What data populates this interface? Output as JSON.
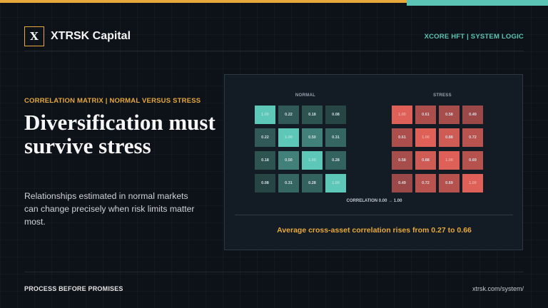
{
  "colors": {
    "accent_gold": "#e6a93a",
    "accent_teal": "#5cc4b4",
    "background": "#0d1219"
  },
  "header": {
    "logo_letter": "X",
    "brand": "XTRSK Capital",
    "tagline": "XCORE HFT | SYSTEM LOGIC"
  },
  "content": {
    "kicker": "CORRELATION MATRIX | NORMAL VERSUS STRESS",
    "headline": "Diversification must survive stress",
    "body": "Relationships estimated in normal markets can change precisely when risk limits matter most."
  },
  "panel": {
    "normal": {
      "title": "NORMAL",
      "values": [
        [
          "1.00",
          "0.22",
          "0.18",
          "0.08"
        ],
        [
          "0.22",
          "1.00",
          "0.50",
          "0.31"
        ],
        [
          "0.18",
          "0.50",
          "1.00",
          "0.28"
        ],
        [
          "0.08",
          "0.31",
          "0.28",
          "1.00"
        ]
      ]
    },
    "stress": {
      "title": "STRESS",
      "values": [
        [
          "1.00",
          "0.61",
          "0.58",
          "0.49"
        ],
        [
          "0.61",
          "1.00",
          "0.88",
          "0.72"
        ],
        [
          "0.58",
          "0.88",
          "1.00",
          "0.69"
        ],
        [
          "0.49",
          "0.72",
          "0.69",
          "1.00"
        ]
      ]
    },
    "scale_label": "CORRELATION 0.00 → 1.00",
    "summary": "Average cross-asset correlation rises from 0.27 to 0.66"
  },
  "footer": {
    "left": "PROCESS BEFORE PROMISES",
    "right": "xtrsk.com/system/"
  }
}
